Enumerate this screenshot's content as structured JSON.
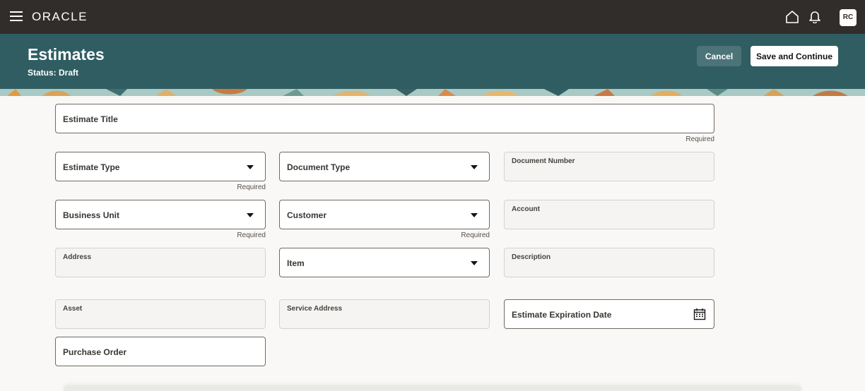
{
  "topbar": {
    "logo": "ORACLE",
    "avatar": "RC",
    "icons": [
      "hamburger-icon",
      "home-icon",
      "bell-icon"
    ]
  },
  "header": {
    "title": "Estimates",
    "status": "Status: Draft",
    "cancel_label": "Cancel",
    "save_label": "Save and Continue"
  },
  "form": {
    "required_text": "Required",
    "estimate_title": "Estimate Title",
    "estimate_type": "Estimate Type",
    "document_type": "Document Type",
    "document_number": "Document Number",
    "business_unit": "Business Unit",
    "customer": "Customer",
    "account": "Account",
    "address": "Address",
    "item": "Item",
    "description": "Description",
    "asset": "Asset",
    "service_address": "Service Address",
    "estimate_expiration_date": "Estimate Expiration Date",
    "purchase_order": "Purchase Order"
  },
  "colors": {
    "topbar": "#312d2a",
    "header": "#2f5d62",
    "background": "#f9f8f6"
  }
}
